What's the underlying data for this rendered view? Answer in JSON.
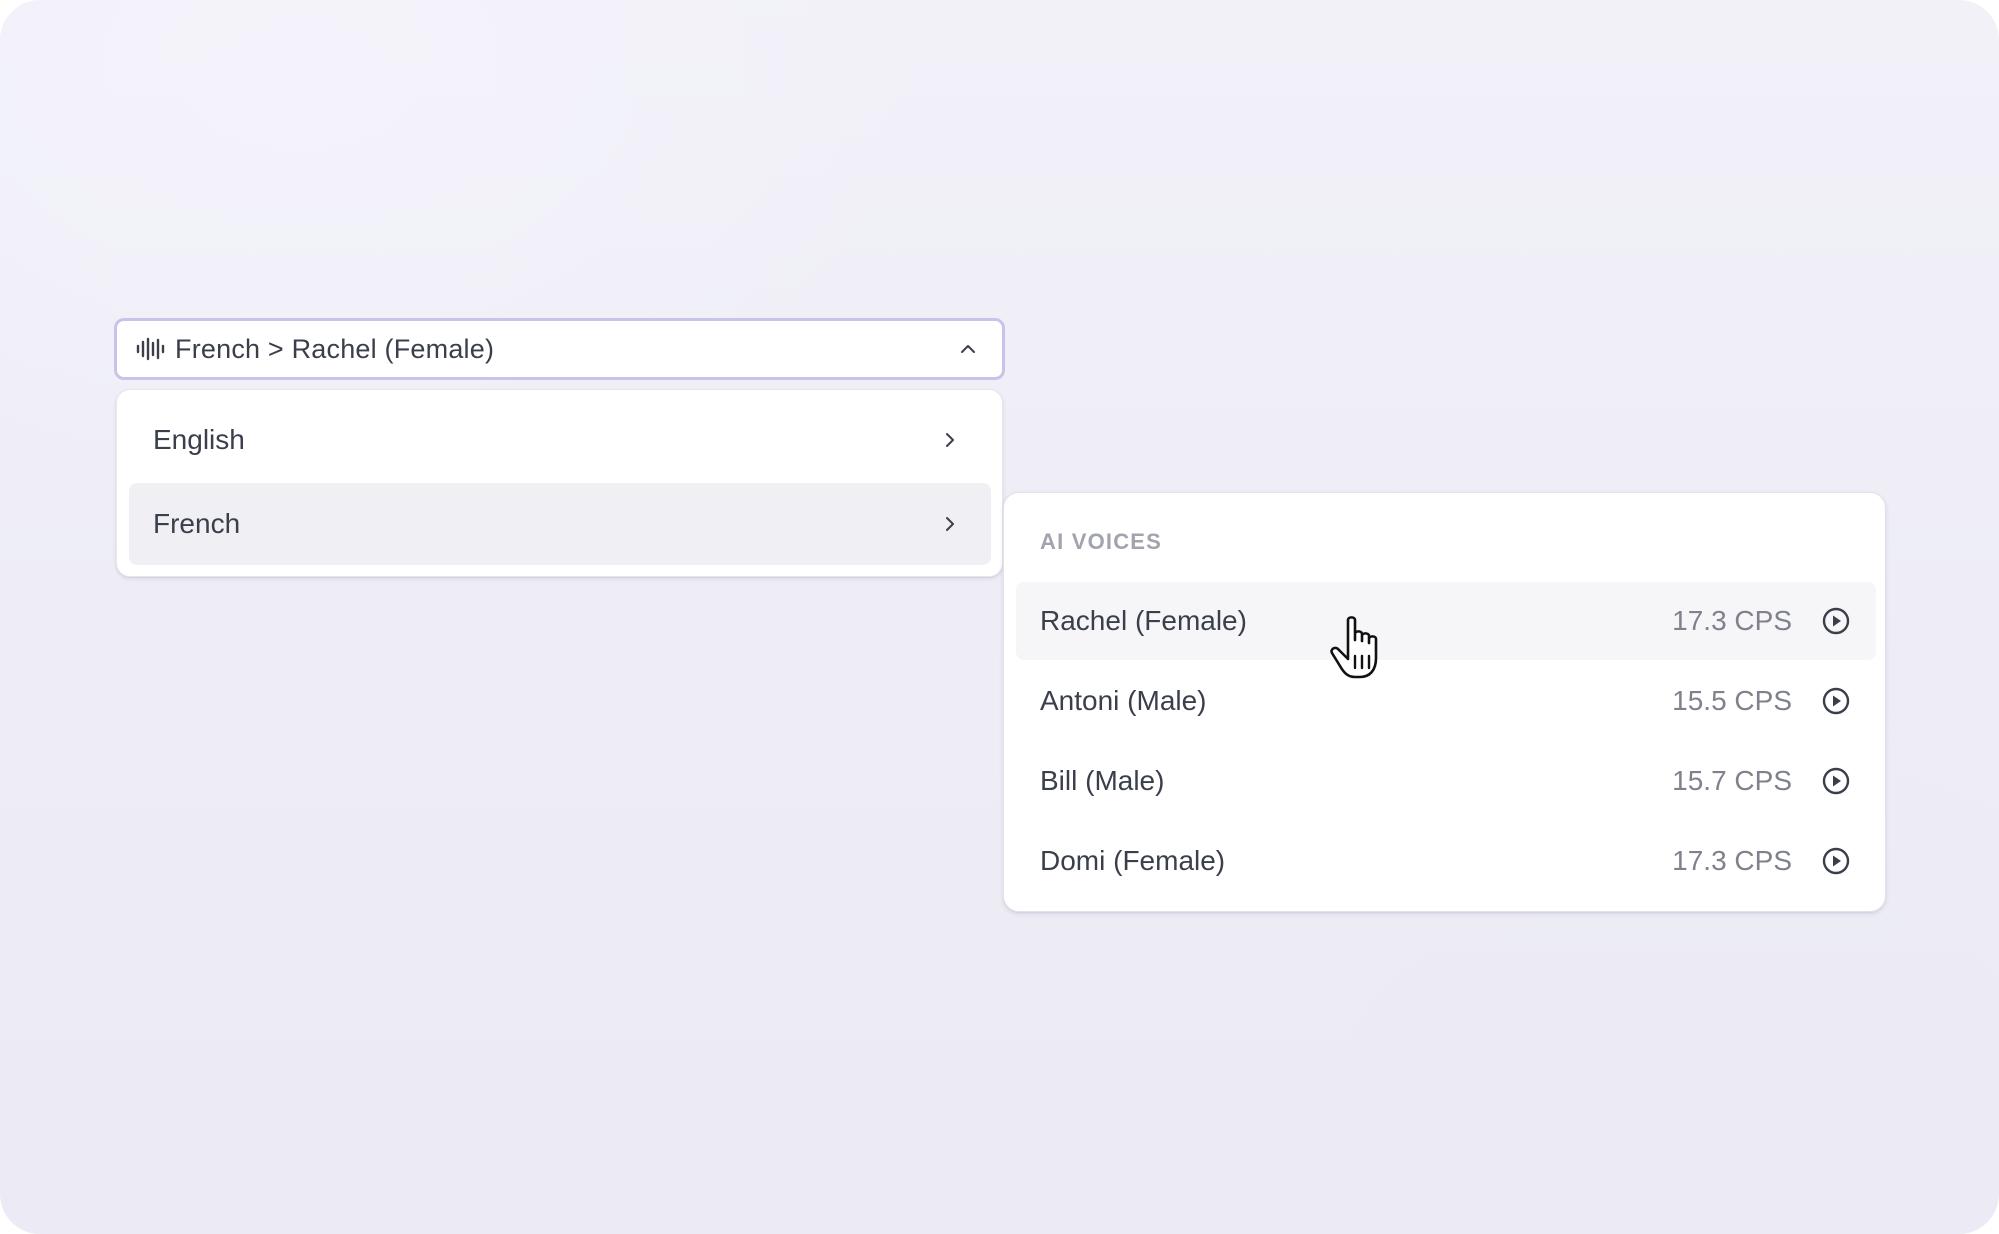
{
  "selector": {
    "value": "French > Rachel (Female)",
    "icon": "audio-wave-icon",
    "caret_icon": "chevron-up-icon"
  },
  "languages": [
    {
      "label": "English",
      "icon": "chevron-right-icon",
      "highlighted": false
    },
    {
      "label": "French",
      "icon": "chevron-right-icon",
      "highlighted": true
    }
  ],
  "voices_panel": {
    "section_title": "AI VOICES",
    "voices": [
      {
        "name": "Rachel (Female)",
        "cps": "17.3 CPS",
        "icon": "play-circle-icon",
        "hovered": true
      },
      {
        "name": "Antoni (Male)",
        "cps": "15.5 CPS",
        "icon": "play-circle-icon",
        "hovered": false
      },
      {
        "name": "Bill (Male)",
        "cps": "15.7 CPS",
        "icon": "play-circle-icon",
        "hovered": false
      },
      {
        "name": "Domi (Female)",
        "cps": "17.3 CPS",
        "icon": "play-circle-icon",
        "hovered": false
      }
    ]
  },
  "colors": {
    "focus_border": "#c9c3ec",
    "text": "#3a3f4b",
    "muted": "#7f828c",
    "hover_bg": "#f0eff3"
  }
}
